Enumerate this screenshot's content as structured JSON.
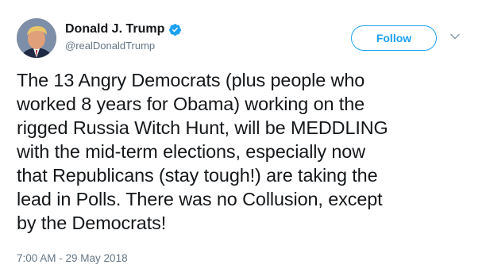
{
  "user": {
    "display_name": "Donald J. Trump",
    "handle": "@realDonaldTrump",
    "verified": true,
    "avatar_icon": "profile-photo"
  },
  "actions": {
    "follow_label": "Follow",
    "menu_icon": "chevron-down-icon"
  },
  "tweet": {
    "text": "The 13 Angry Democrats (plus people who\nworked 8 years for Obama) working on the\nrigged Russia Witch Hunt, will be MEDDLING\nwith the mid-term elections, especially now\nthat Republicans (stay tough!) are taking the\nlead in Polls. There was no Collusion, except\nby the Democrats!",
    "timestamp": "7:00 AM - 29 May 2018"
  },
  "colors": {
    "accent": "#1da1f2",
    "text": "#14171a",
    "secondary_text": "#657786"
  }
}
